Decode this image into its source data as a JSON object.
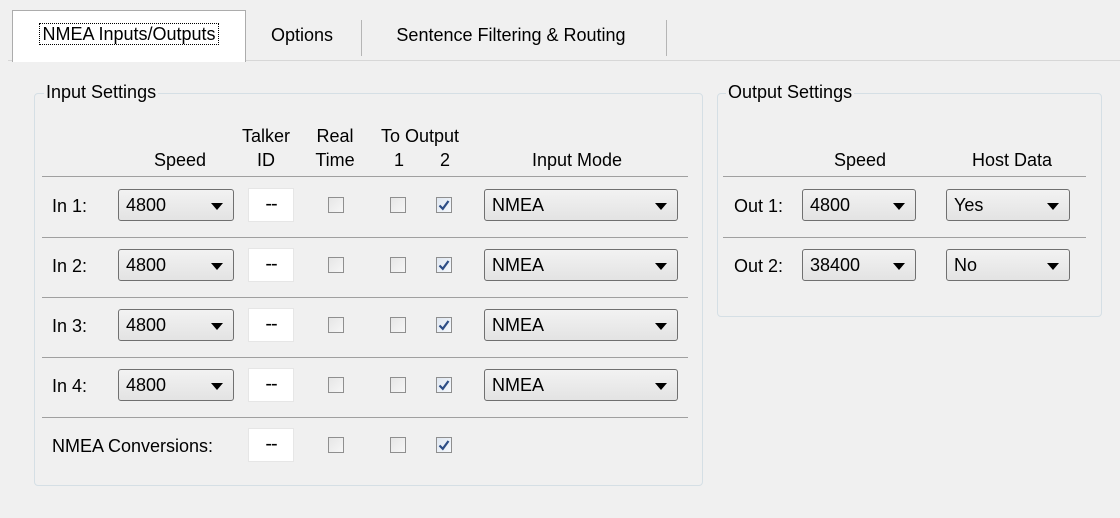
{
  "tabs": [
    {
      "label": "NMEA Inputs/Outputs",
      "active": true
    },
    {
      "label": "Options",
      "active": false
    },
    {
      "label": "Sentence Filtering & Routing",
      "active": false
    }
  ],
  "input_settings": {
    "title": "Input Settings",
    "headers": {
      "speed": "Speed",
      "talker_top": "Talker",
      "talker_bottom": "ID",
      "real_top": "Real",
      "real_bottom": "Time",
      "to_output": "To Output",
      "out1": "1",
      "out2": "2",
      "input_mode": "Input Mode"
    },
    "rows": [
      {
        "label": "In 1:",
        "speed": "4800",
        "talker_id": "--",
        "real_time": false,
        "out1": false,
        "out2": true,
        "mode": "NMEA"
      },
      {
        "label": "In 2:",
        "speed": "4800",
        "talker_id": "--",
        "real_time": false,
        "out1": false,
        "out2": true,
        "mode": "NMEA"
      },
      {
        "label": "In 3:",
        "speed": "4800",
        "talker_id": "--",
        "real_time": false,
        "out1": false,
        "out2": true,
        "mode": "NMEA"
      },
      {
        "label": "In 4:",
        "speed": "4800",
        "talker_id": "--",
        "real_time": false,
        "out1": false,
        "out2": true,
        "mode": "NMEA"
      }
    ],
    "conversions": {
      "label": "NMEA Conversions:",
      "talker_id": "--",
      "real_time": false,
      "out1": false,
      "out2": true
    }
  },
  "output_settings": {
    "title": "Output Settings",
    "headers": {
      "speed": "Speed",
      "host_data": "Host Data"
    },
    "rows": [
      {
        "label": "Out 1:",
        "speed": "4800",
        "host_data": "Yes"
      },
      {
        "label": "Out 2:",
        "speed": "38400",
        "host_data": "No"
      }
    ]
  },
  "icons": {
    "dropdown": "chevron-down-icon",
    "check": "checkmark-icon"
  },
  "colors": {
    "check": "#2e4e86",
    "group_border": "#d5dfe5",
    "active_tab": "#ffffff"
  }
}
